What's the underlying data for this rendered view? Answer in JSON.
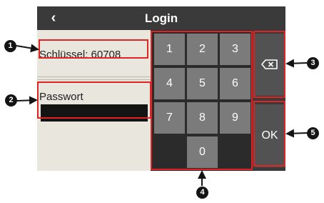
{
  "header": {
    "title": "Login",
    "back_icon": "chevron-left-icon"
  },
  "login": {
    "key_label": "Schlüssel: 60708",
    "password_label": "Passwort",
    "password_value": ""
  },
  "keypad": {
    "keys": [
      "1",
      "2",
      "3",
      "4",
      "5",
      "6",
      "7",
      "8",
      "9",
      "0"
    ]
  },
  "side_buttons": {
    "backspace_icon": "backspace-icon",
    "ok_label": "OK"
  },
  "annotations": [
    "1",
    "2",
    "3",
    "4",
    "5"
  ],
  "colors": {
    "annotation_red": "#e02424",
    "title_bar": "#3a3a3a",
    "key_gray": "#7b7b7b",
    "panel_bg": "#e8e6dd"
  }
}
